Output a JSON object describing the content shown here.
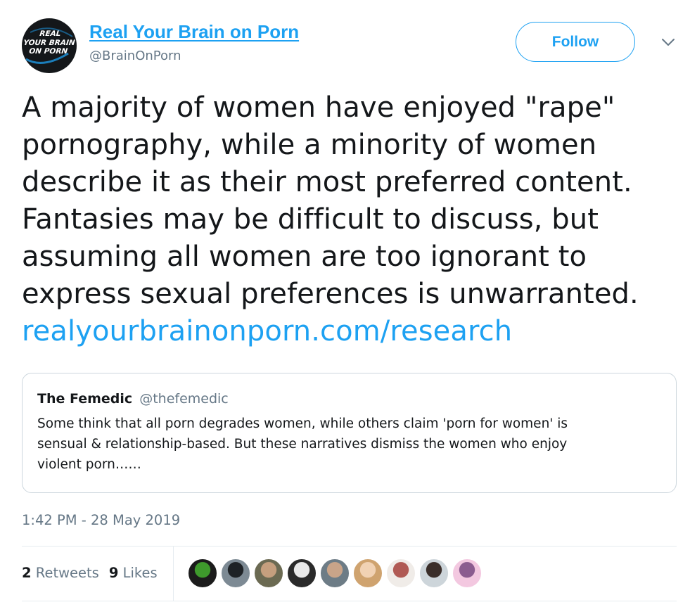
{
  "author": {
    "display_name": "Real Your Brain on Porn",
    "handle": "@BrainOnPorn",
    "avatar_lines": [
      "REAL",
      "YOUR BRAIN",
      "ON PORN"
    ]
  },
  "actions": {
    "follow_label": "Follow",
    "more_icon": "chevron-down-icon"
  },
  "tweet": {
    "lines": [
      "A majority of women have enjoyed \"rape\"",
      "pornography, while a minority of women",
      "describe it as their most preferred content.",
      "Fantasies may be difficult to discuss, but",
      "assuming all women are too ignorant to",
      "express sexual preferences is unwarranted."
    ],
    "link": "realyourbrainonporn.com/research"
  },
  "quote": {
    "name": "The Femedic",
    "handle": "@thefemedic",
    "lines": [
      "Some think that all porn degrades women, while others claim 'porn for women' is",
      "sensual & relationship-based. But these narratives dismiss the women who enjoy",
      "violent porn……"
    ]
  },
  "timestamp": "1:42 PM - 28 May 2019",
  "stats": {
    "retweets_count": "2",
    "retweets_label": "Retweets",
    "likes_count": "9",
    "likes_label": "Likes"
  },
  "likers": [
    {
      "name": "liker-avatar-1",
      "colors": [
        "#1b1b1b",
        "#3e9a2c"
      ]
    },
    {
      "name": "liker-avatar-2",
      "colors": [
        "#7d8a94",
        "#1e2226"
      ]
    },
    {
      "name": "liker-avatar-3",
      "colors": [
        "#6b6a52",
        "#c59f7e"
      ]
    },
    {
      "name": "liker-avatar-4",
      "colors": [
        "#2a2a2a",
        "#e9e9e9"
      ]
    },
    {
      "name": "liker-avatar-5",
      "colors": [
        "#6d7c86",
        "#c9a489"
      ]
    },
    {
      "name": "liker-avatar-6",
      "colors": [
        "#cfa36f",
        "#f1d2b4"
      ]
    },
    {
      "name": "liker-avatar-7",
      "colors": [
        "#f0ece8",
        "#b05a54"
      ]
    },
    {
      "name": "liker-avatar-8",
      "colors": [
        "#cdd5da",
        "#3a2e2a"
      ]
    },
    {
      "name": "liker-avatar-9",
      "colors": [
        "#f3c8e0",
        "#8b5c8f"
      ]
    }
  ],
  "colors": {
    "accent": "#1da1f2",
    "text": "#14171a",
    "secondary": "#657786",
    "border": "#ccd6dd"
  }
}
